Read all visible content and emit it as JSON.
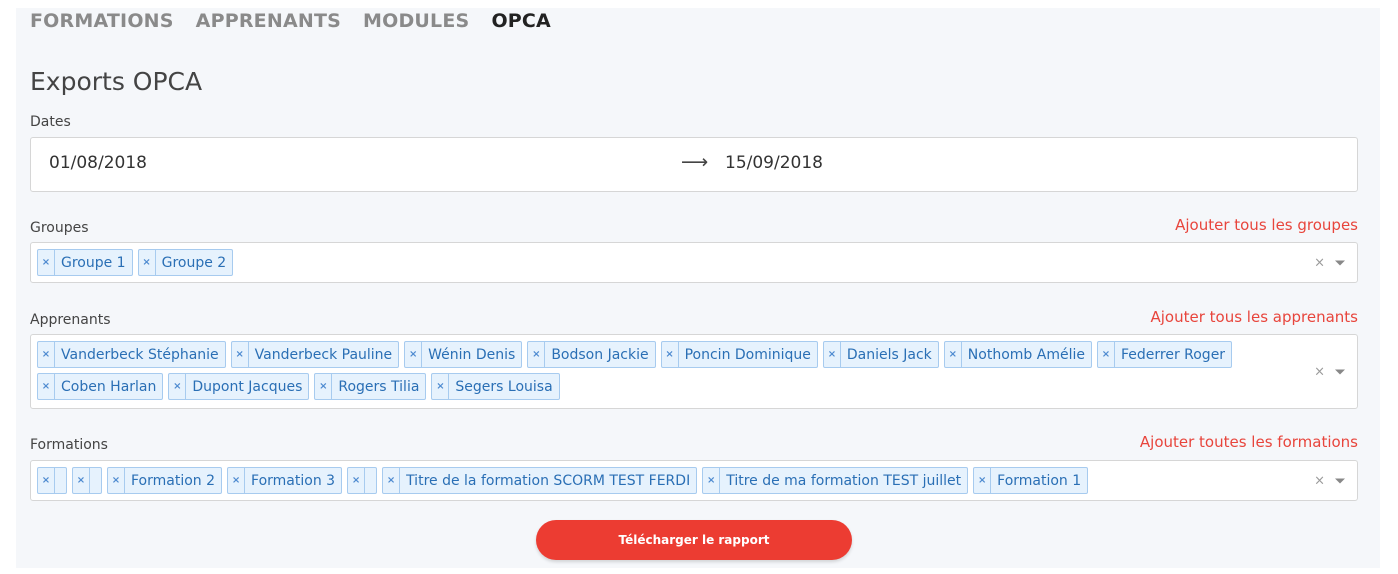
{
  "nav": {
    "items": [
      {
        "label": "FORMATIONS",
        "active": false
      },
      {
        "label": "APPRENANTS",
        "active": false
      },
      {
        "label": "MODULES",
        "active": false
      },
      {
        "label": "OPCA",
        "active": true
      }
    ]
  },
  "page": {
    "title": "Exports OPCA"
  },
  "dates": {
    "label": "Dates",
    "from": "01/08/2018",
    "arrow": "⟶",
    "to": "15/09/2018"
  },
  "groupes": {
    "label": "Groupes",
    "add_all": "Ajouter tous les groupes",
    "tags": [
      "Groupe 1",
      "Groupe 2"
    ]
  },
  "apprenants": {
    "label": "Apprenants",
    "add_all": "Ajouter tous les apprenants",
    "tags": [
      "Vanderbeck Stéphanie",
      "Vanderbeck Pauline",
      "Wénin Denis",
      "Bodson Jackie",
      "Poncin Dominique",
      "Daniels Jack",
      "Nothomb Amélie",
      "Federrer Roger",
      "Coben Harlan",
      "Dupont Jacques",
      "Rogers Tilia",
      "Segers Louisa"
    ]
  },
  "formations": {
    "label": "Formations",
    "add_all": "Ajouter toutes les formations",
    "tags": [
      "",
      "",
      "Formation 2",
      "Formation 3",
      "",
      "Titre de la formation SCORM TEST FERDI",
      "Titre de ma formation TEST juillet",
      "Formation 1"
    ]
  },
  "icons": {
    "remove": "×",
    "clear": "×"
  },
  "download": {
    "label": "Télécharger le rapport"
  },
  "colors": {
    "accent": "#ec3c32",
    "link": "#e8453c",
    "tag_bg": "#e6f2fd",
    "tag_border": "#a7cbef",
    "tag_text": "#2a6fb5"
  }
}
